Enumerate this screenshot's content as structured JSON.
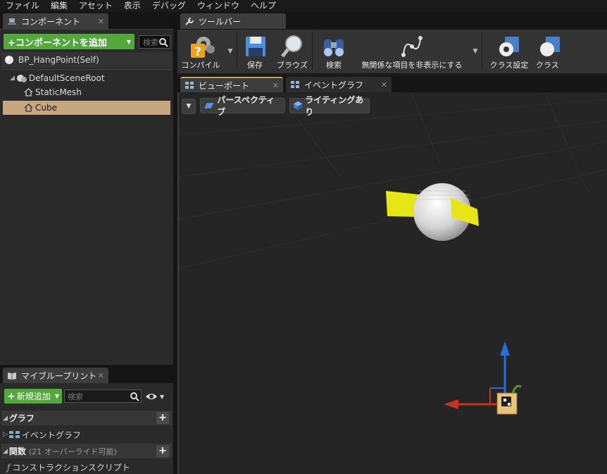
{
  "menu": [
    "ファイル",
    "編集",
    "アセット",
    "表示",
    "デバッグ",
    "ウィンドウ",
    "ヘルプ"
  ],
  "components_panel": {
    "tab_label": "コンポーネント",
    "add_button_label": "+コンポーネントを追加",
    "search_placeholder": "検索",
    "self_item": "BP_HangPoint(Self)",
    "tree": [
      {
        "label": "DefaultSceneRoot"
      },
      {
        "label": "StaticMesh"
      },
      {
        "label": "Cube"
      }
    ]
  },
  "toolbar_tab": {
    "label": "ツールバー"
  },
  "toolbar": {
    "buttons": [
      {
        "label": "コンパイル",
        "icon": "compile-icon"
      },
      {
        "label": "保存",
        "icon": "save-icon"
      },
      {
        "label": "ブラウズ",
        "icon": "browse-icon"
      },
      {
        "label": "検索",
        "icon": "binoculars-icon"
      },
      {
        "label": "無関係な項目を非表示にする",
        "icon": "hide-unrelated-icon"
      },
      {
        "label": "クラス設定",
        "icon": "class-settings-icon"
      },
      {
        "label": "クラス",
        "icon": "class-defaults-icon"
      }
    ]
  },
  "editor_tabs": [
    {
      "label": "ビューポート"
    },
    {
      "label": "イベントグラフ"
    }
  ],
  "viewport": {
    "perspective_label": "パースペクティブ",
    "lighting_label": "ライティングあり"
  },
  "my_blueprint": {
    "tab_label": "マイブループリント",
    "add_new_label": "新規追加",
    "search_placeholder": "検索",
    "graph_section": "グラフ",
    "event_graph_item": "イベントグラフ",
    "functions_section": "関数",
    "functions_note": "(21 オーバーライド可能)",
    "construction_script_item": "コンストラクションスクリプト"
  },
  "colors": {
    "accent_green": "#53a83c",
    "selection": "#c7a77f",
    "gizmo_x": "#c8321e",
    "gizmo_z": "#2a6fd8",
    "cube_yellow": "#e6e617"
  }
}
